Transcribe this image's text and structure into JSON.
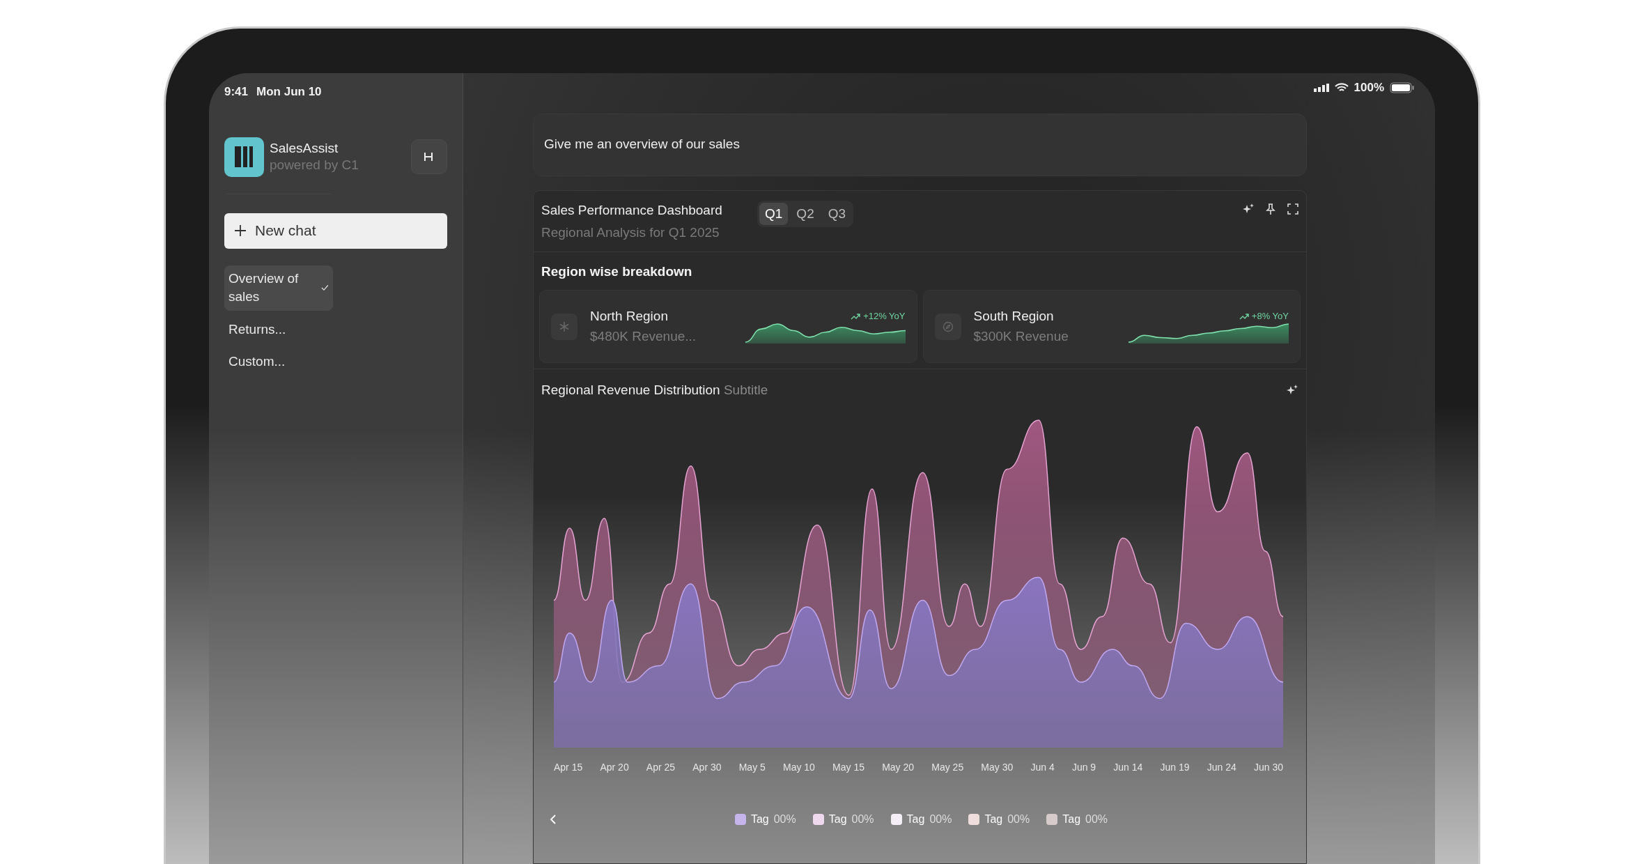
{
  "status_bar": {
    "time": "9:41",
    "date": "Mon Jun 10",
    "battery": "100%"
  },
  "sidebar": {
    "app_name": "SalesAssist",
    "app_subtitle": "powered by C1",
    "new_chat": "New chat",
    "chats": [
      {
        "label": "Overview of sales",
        "selected": true
      },
      {
        "label": "Returns...",
        "selected": false
      },
      {
        "label": "Custom...",
        "selected": false
      }
    ]
  },
  "prompt": "Give me an overview of our sales",
  "dashboard": {
    "title": "Sales Performance Dashboard",
    "subtitle": "Regional Analysis for Q1 2025",
    "tabs": [
      {
        "label": "Q1",
        "selected": true
      },
      {
        "label": "Q2",
        "selected": false
      },
      {
        "label": "Q3",
        "selected": false
      }
    ],
    "section_title": "Region wise breakdown",
    "regions": [
      {
        "kind": "snowflake",
        "name": "North Region",
        "revenue": "$480K Revenue...",
        "trend": "+12% YoY"
      },
      {
        "kind": "compass",
        "name": "South Region",
        "revenue": "$300K Revenue",
        "trend": "+8% YoY"
      }
    ],
    "chart": {
      "title": "Regional Revenue Distribution",
      "subtitle": "Subtitle",
      "x_labels": [
        "Apr 15",
        "Apr 20",
        "Apr 25",
        "Apr 30",
        "May 5",
        "May 10",
        "May 15",
        "May 20",
        "May 25",
        "May 30",
        "Jun 4",
        "Jun 9",
        "Jun 14",
        "Jun 19",
        "Jun 24",
        "Jun 30"
      ],
      "legend": [
        {
          "label": "Tag",
          "value": "00%",
          "color": "#c6b4ec"
        },
        {
          "label": "Tag",
          "value": "00%",
          "color": "#eed8ee"
        },
        {
          "label": "Tag",
          "value": "00%",
          "color": "#f6eef6"
        },
        {
          "label": "Tag",
          "value": "00%",
          "color": "#efdcdc"
        },
        {
          "label": "Tag",
          "value": "00%",
          "color": "#d6caca"
        }
      ]
    }
  }
}
